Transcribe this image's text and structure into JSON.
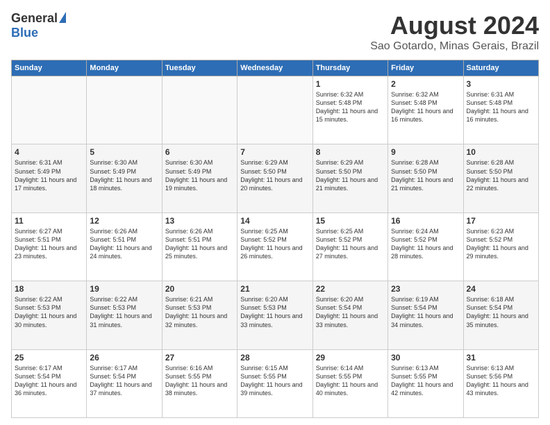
{
  "header": {
    "logo_general": "General",
    "logo_blue": "Blue",
    "month_title": "August 2024",
    "location": "Sao Gotardo, Minas Gerais, Brazil"
  },
  "columns": [
    "Sunday",
    "Monday",
    "Tuesday",
    "Wednesday",
    "Thursday",
    "Friday",
    "Saturday"
  ],
  "weeks": [
    [
      {
        "day": "",
        "info": ""
      },
      {
        "day": "",
        "info": ""
      },
      {
        "day": "",
        "info": ""
      },
      {
        "day": "",
        "info": ""
      },
      {
        "day": "1",
        "info": "Sunrise: 6:32 AM\nSunset: 5:48 PM\nDaylight: 11 hours\nand 15 minutes."
      },
      {
        "day": "2",
        "info": "Sunrise: 6:32 AM\nSunset: 5:48 PM\nDaylight: 11 hours\nand 16 minutes."
      },
      {
        "day": "3",
        "info": "Sunrise: 6:31 AM\nSunset: 5:48 PM\nDaylight: 11 hours\nand 16 minutes."
      }
    ],
    [
      {
        "day": "4",
        "info": "Sunrise: 6:31 AM\nSunset: 5:49 PM\nDaylight: 11 hours\nand 17 minutes."
      },
      {
        "day": "5",
        "info": "Sunrise: 6:30 AM\nSunset: 5:49 PM\nDaylight: 11 hours\nand 18 minutes."
      },
      {
        "day": "6",
        "info": "Sunrise: 6:30 AM\nSunset: 5:49 PM\nDaylight: 11 hours\nand 19 minutes."
      },
      {
        "day": "7",
        "info": "Sunrise: 6:29 AM\nSunset: 5:50 PM\nDaylight: 11 hours\nand 20 minutes."
      },
      {
        "day": "8",
        "info": "Sunrise: 6:29 AM\nSunset: 5:50 PM\nDaylight: 11 hours\nand 21 minutes."
      },
      {
        "day": "9",
        "info": "Sunrise: 6:28 AM\nSunset: 5:50 PM\nDaylight: 11 hours\nand 21 minutes."
      },
      {
        "day": "10",
        "info": "Sunrise: 6:28 AM\nSunset: 5:50 PM\nDaylight: 11 hours\nand 22 minutes."
      }
    ],
    [
      {
        "day": "11",
        "info": "Sunrise: 6:27 AM\nSunset: 5:51 PM\nDaylight: 11 hours\nand 23 minutes."
      },
      {
        "day": "12",
        "info": "Sunrise: 6:26 AM\nSunset: 5:51 PM\nDaylight: 11 hours\nand 24 minutes."
      },
      {
        "day": "13",
        "info": "Sunrise: 6:26 AM\nSunset: 5:51 PM\nDaylight: 11 hours\nand 25 minutes."
      },
      {
        "day": "14",
        "info": "Sunrise: 6:25 AM\nSunset: 5:52 PM\nDaylight: 11 hours\nand 26 minutes."
      },
      {
        "day": "15",
        "info": "Sunrise: 6:25 AM\nSunset: 5:52 PM\nDaylight: 11 hours\nand 27 minutes."
      },
      {
        "day": "16",
        "info": "Sunrise: 6:24 AM\nSunset: 5:52 PM\nDaylight: 11 hours\nand 28 minutes."
      },
      {
        "day": "17",
        "info": "Sunrise: 6:23 AM\nSunset: 5:52 PM\nDaylight: 11 hours\nand 29 minutes."
      }
    ],
    [
      {
        "day": "18",
        "info": "Sunrise: 6:22 AM\nSunset: 5:53 PM\nDaylight: 11 hours\nand 30 minutes."
      },
      {
        "day": "19",
        "info": "Sunrise: 6:22 AM\nSunset: 5:53 PM\nDaylight: 11 hours\nand 31 minutes."
      },
      {
        "day": "20",
        "info": "Sunrise: 6:21 AM\nSunset: 5:53 PM\nDaylight: 11 hours\nand 32 minutes."
      },
      {
        "day": "21",
        "info": "Sunrise: 6:20 AM\nSunset: 5:53 PM\nDaylight: 11 hours\nand 33 minutes."
      },
      {
        "day": "22",
        "info": "Sunrise: 6:20 AM\nSunset: 5:54 PM\nDaylight: 11 hours\nand 33 minutes."
      },
      {
        "day": "23",
        "info": "Sunrise: 6:19 AM\nSunset: 5:54 PM\nDaylight: 11 hours\nand 34 minutes."
      },
      {
        "day": "24",
        "info": "Sunrise: 6:18 AM\nSunset: 5:54 PM\nDaylight: 11 hours\nand 35 minutes."
      }
    ],
    [
      {
        "day": "25",
        "info": "Sunrise: 6:17 AM\nSunset: 5:54 PM\nDaylight: 11 hours\nand 36 minutes."
      },
      {
        "day": "26",
        "info": "Sunrise: 6:17 AM\nSunset: 5:54 PM\nDaylight: 11 hours\nand 37 minutes."
      },
      {
        "day": "27",
        "info": "Sunrise: 6:16 AM\nSunset: 5:55 PM\nDaylight: 11 hours\nand 38 minutes."
      },
      {
        "day": "28",
        "info": "Sunrise: 6:15 AM\nSunset: 5:55 PM\nDaylight: 11 hours\nand 39 minutes."
      },
      {
        "day": "29",
        "info": "Sunrise: 6:14 AM\nSunset: 5:55 PM\nDaylight: 11 hours\nand 40 minutes."
      },
      {
        "day": "30",
        "info": "Sunrise: 6:13 AM\nSunset: 5:55 PM\nDaylight: 11 hours\nand 42 minutes."
      },
      {
        "day": "31",
        "info": "Sunrise: 6:13 AM\nSunset: 5:56 PM\nDaylight: 11 hours\nand 43 minutes."
      }
    ]
  ]
}
